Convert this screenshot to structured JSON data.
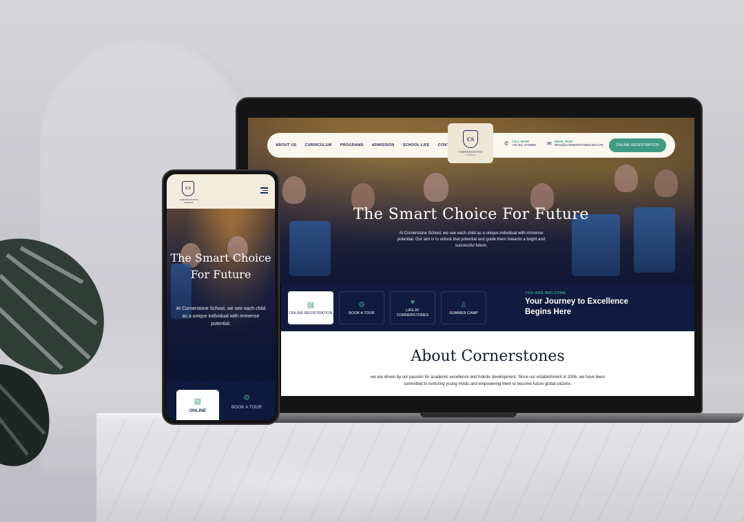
{
  "desktop": {
    "nav_links": [
      "ABOUT US",
      "CURRICULUM",
      "PROGRAMS",
      "ADMISSION",
      "SCHOOL LIFE",
      "CONTACT"
    ],
    "logo": {
      "initials": "CS",
      "name": "CORNERSTONES",
      "sub": "SCHOOL"
    },
    "call": {
      "label": "CALL NOW!",
      "value": "+92 301 3778889"
    },
    "email": {
      "label": "EMAIL NOW",
      "value": "INFO@CORNERSTONES.EDU.PK"
    },
    "register_button": "ONLINE REGISTRATION",
    "hero_title": "The Smart Choice For Future",
    "hero_subtitle": "At Cornerstone School, we see each child as a unique individual with immense potential. Our aim is to unlock that potential and guide them towards a bright and successful future.",
    "cta_cards": [
      {
        "icon": "document-icon",
        "label": "ONLINE REGISTRATION",
        "active": true
      },
      {
        "icon": "group-icon",
        "label": "BOOK A TOUR",
        "active": false
      },
      {
        "icon": "heart-icon",
        "label": "LIFE AT CORNERSTONES",
        "active": false
      },
      {
        "icon": "people-icon",
        "label": "SUMMER CAMP",
        "active": false
      }
    ],
    "welcome_kicker": "YOU ARE WELCOME",
    "welcome_title": "Your Journey to Excellence Begins Here",
    "about_title": "About Cornerstones",
    "about_body": "we are driven by our passion for academic excellence and holistic development. Since our establishment in 2006, we have been committed to nurturing young minds and empowering them to become future global citizens."
  },
  "mobile": {
    "logo_initials": "CS",
    "logo_name": "CORNERSTONES SCHOOL",
    "hero_title": "The Smart Choice For Future",
    "hero_subtitle": "At Cornerstone School, we see each child as a unique individual with immense potential.",
    "cta_primary": "ONLINE",
    "cta_secondary": "BOOK A TOUR"
  },
  "colors": {
    "navy": "#101b3f",
    "accent": "#3f9b83",
    "cream": "#fbf7ee"
  }
}
